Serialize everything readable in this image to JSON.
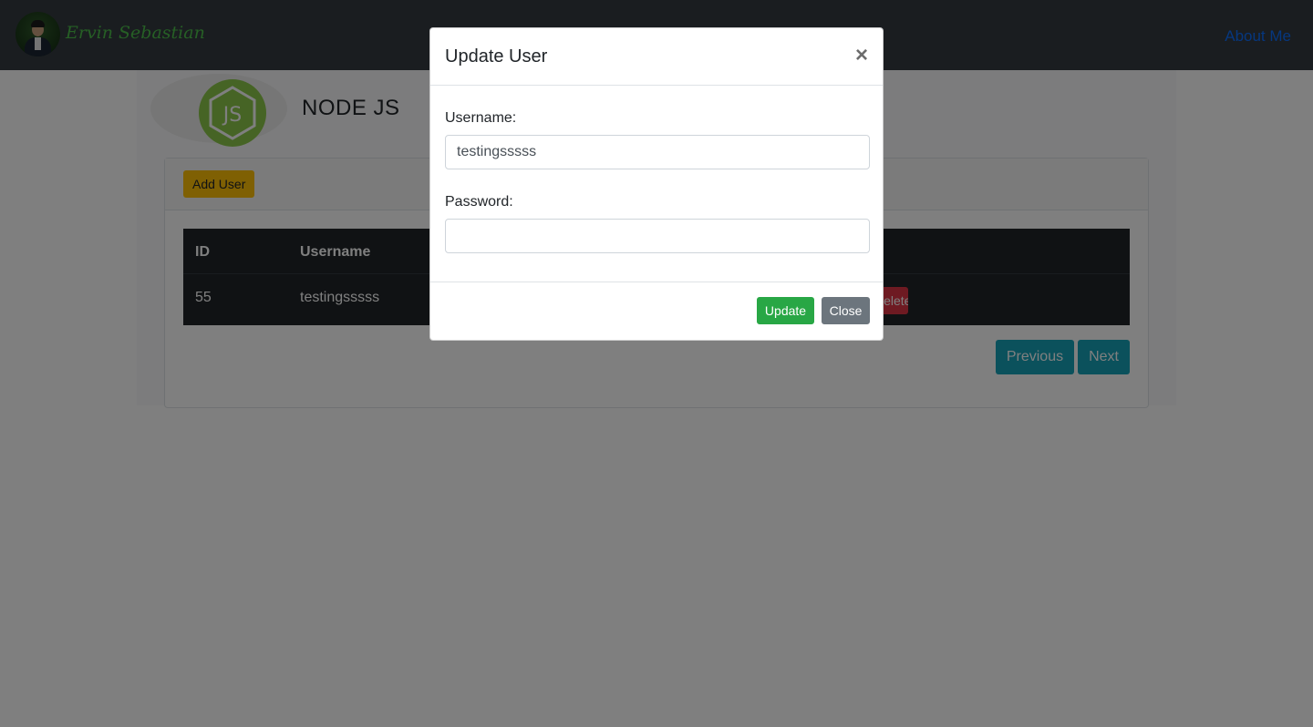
{
  "navbar": {
    "brand_name": "Ervin Sebastian",
    "about_link": "About Me"
  },
  "page": {
    "title": "NODE JS",
    "add_user_label": "Add User"
  },
  "table": {
    "headers": [
      "ID",
      "Username"
    ],
    "rows": [
      {
        "id": "55",
        "username": "testingsssss",
        "delete_label": "Delete"
      }
    ]
  },
  "pagination": {
    "previous_label": "Previous",
    "next_label": "Next"
  },
  "modal": {
    "title": "Update User",
    "close_symbol": "×",
    "username_label": "Username:",
    "username_value": "testingsssss",
    "password_label": "Password:",
    "password_value": "",
    "update_label": "Update",
    "close_label": "Close"
  },
  "colors": {
    "navbar_bg": "#343a40",
    "add_button": "#ffc107",
    "update_button": "#28a745",
    "close_button": "#6c757d",
    "pager_button": "#17a2b8",
    "delete_button": "#dc3545",
    "brand_text": "#4cbf4a",
    "link": "#0d6efd"
  }
}
